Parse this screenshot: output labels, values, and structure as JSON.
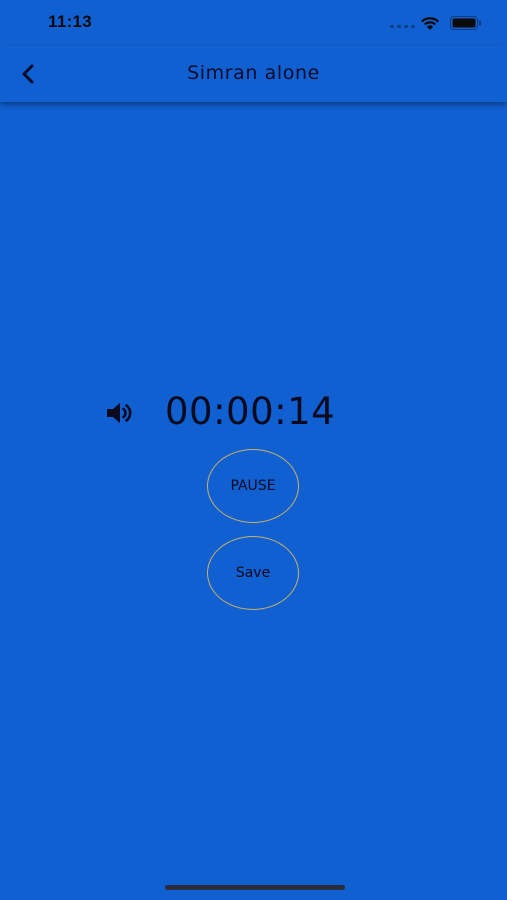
{
  "status_bar": {
    "time": "11:13",
    "icons": [
      "signal-dots-icon",
      "wifi-icon",
      "battery-icon"
    ]
  },
  "nav": {
    "back_icon": "chevron-left-icon",
    "title": "Simran alone"
  },
  "timer": {
    "sound_icon": "speaker-icon",
    "elapsed": "00:00:14"
  },
  "actions": {
    "pause_label": "PAUSE",
    "save_label": "Save"
  },
  "colors": {
    "background": "#1160d2",
    "button_border": "#c8b066",
    "text": "#0a0a1e"
  }
}
